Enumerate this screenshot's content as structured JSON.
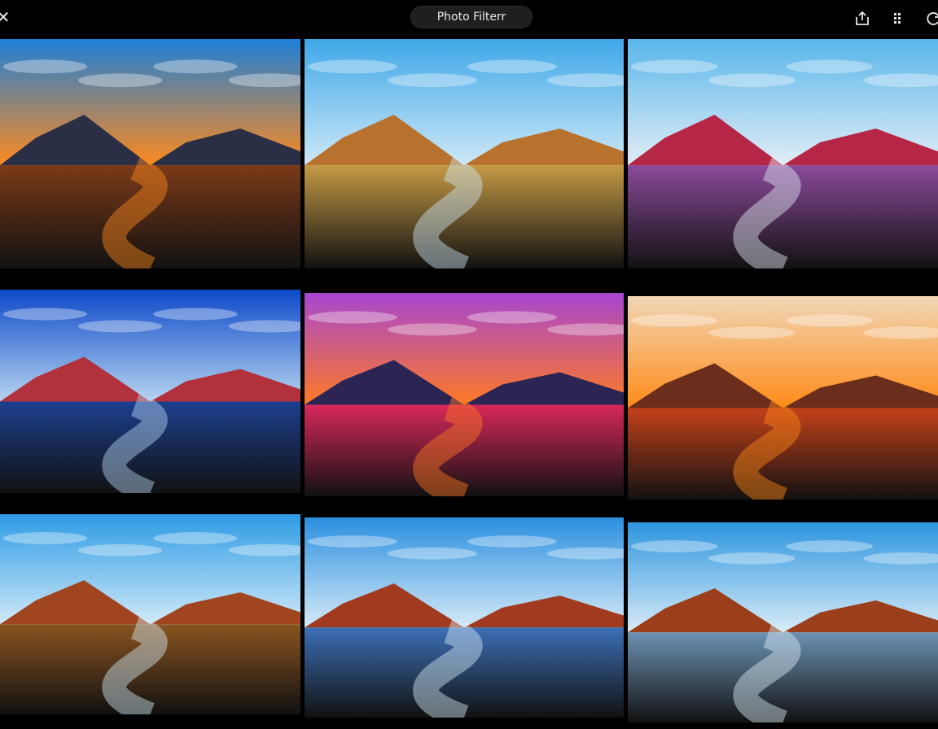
{
  "app": {
    "title": "Photo Filterr"
  },
  "toolbar": {
    "close_icon": "close-icon",
    "share_icon": "share-icon",
    "grid_icon": "grid-icon",
    "sync_icon": "refresh-icon"
  },
  "thumbnails": [
    {
      "filter": "sunset-field",
      "sky_top": "#1e7fd8",
      "sky_bottom": "#ff8a1c",
      "mountain": "#2b2f45",
      "ground": "#7a3a18"
    },
    {
      "filter": "golden-sky",
      "sky_top": "#3fa7e8",
      "sky_bottom": "#cfe9f7",
      "mountain": "#b8722d",
      "ground": "#c59a45"
    },
    {
      "filter": "magenta",
      "sky_top": "#58b6ea",
      "sky_bottom": "#e4eef6",
      "mountain": "#b62747",
      "ground": "#8b4a9b"
    },
    {
      "filter": "deep-blue",
      "sky_top": "#0d49c9",
      "sky_bottom": "#b9d6f1",
      "mountain": "#b1323c",
      "ground": "#1d3f8f"
    },
    {
      "filter": "violet-dusk",
      "sky_top": "#a646d1",
      "sky_bottom": "#ff7a22",
      "mountain": "#2c2554",
      "ground": "#d9285a"
    },
    {
      "filter": "amber-glow",
      "sky_top": "#f1d6b6",
      "sky_bottom": "#ff8a16",
      "mountain": "#6b2d1c",
      "ground": "#c5411a"
    },
    {
      "filter": "warm-earth",
      "sky_top": "#2d9be5",
      "sky_bottom": "#d3eaf7",
      "mountain": "#a14520",
      "ground": "#8a5420"
    },
    {
      "filter": "cool-water",
      "sky_top": "#2b8fe0",
      "sky_bottom": "#d7ebf7",
      "mountain": "#a13a1f",
      "ground": "#3c6fb6"
    },
    {
      "filter": "pale-cyan",
      "sky_top": "#2c95df",
      "sky_bottom": "#dcedf7",
      "mountain": "#9a3e1c",
      "ground": "#6d92b4"
    }
  ]
}
